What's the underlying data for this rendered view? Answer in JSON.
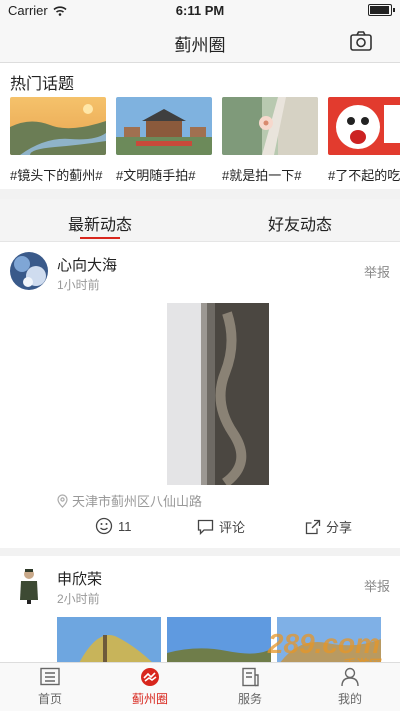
{
  "status_bar": {
    "carrier": "Carrier",
    "time": "6:11 PM",
    "battery_level": 0.95
  },
  "nav": {
    "title": "蓟州圈",
    "camera_icon": "camera-icon"
  },
  "hot_topics": {
    "title": "热门话题",
    "items": [
      {
        "label": "#镜头下的蓟州#",
        "palette": [
          "#f0b35a",
          "#6f8f74"
        ]
      },
      {
        "label": "#文明随手拍#",
        "palette": [
          "#78a9d8",
          "#7c8f6d"
        ]
      },
      {
        "label": "#就是拍一下#",
        "palette": [
          "#9fb7a0",
          "#e9e4dc"
        ]
      },
      {
        "label": "#了不起的吃",
        "palette": [
          "#e23b2e",
          "#ffffff"
        ]
      }
    ]
  },
  "tabs": {
    "latest": "最新动态",
    "friends": "好友动态"
  },
  "posts": [
    {
      "name": "心向大海",
      "ago": "1小时前",
      "report": "举报",
      "location": "天津市蓟州区八仙山路",
      "likes": "11",
      "comment": "评论",
      "share": "分享"
    },
    {
      "name": "申欣荣",
      "ago": "2小时前",
      "report": "举报"
    }
  ],
  "tabbar": {
    "items": [
      {
        "label": "首页",
        "icon": "home-icon"
      },
      {
        "label": "蓟州圈",
        "icon": "jizhou-circle-icon",
        "active": true
      },
      {
        "label": "服务",
        "icon": "service-icon"
      },
      {
        "label": "我的",
        "icon": "profile-icon"
      }
    ]
  },
  "watermark": {
    "text": "289.com",
    "subtext": "手游网"
  },
  "colors": {
    "accent": "#d8261d",
    "band": "#f2f2f2"
  }
}
